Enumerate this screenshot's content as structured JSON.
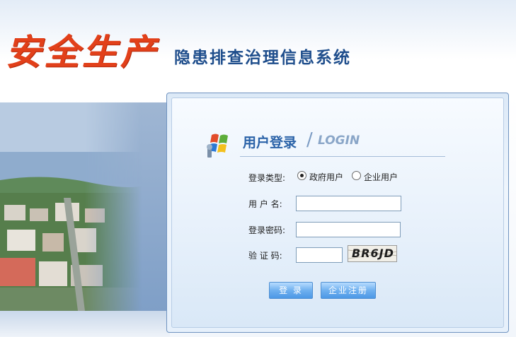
{
  "header": {
    "brand_text": "安全生产",
    "system_title": "隐患排查治理信息系统"
  },
  "login": {
    "title": "用户登录",
    "separator": "/",
    "title_en": "LOGIN",
    "type_label": "登录类型:",
    "type_options": [
      {
        "label": "政府用户",
        "selected": true
      },
      {
        "label": "企业用户",
        "selected": false
      }
    ],
    "username_label": "用 户 名:",
    "username_value": "",
    "password_label": "登录密码:",
    "password_value": "",
    "captcha_label": "验 证 码:",
    "captcha_value": "",
    "captcha_image_text": "BR6JD",
    "login_button": "登 录",
    "register_button": "企业注册"
  },
  "colors": {
    "brand_red": "#e2401a",
    "title_blue": "#1f4e8c",
    "button_blue": "#6fb0ef"
  }
}
